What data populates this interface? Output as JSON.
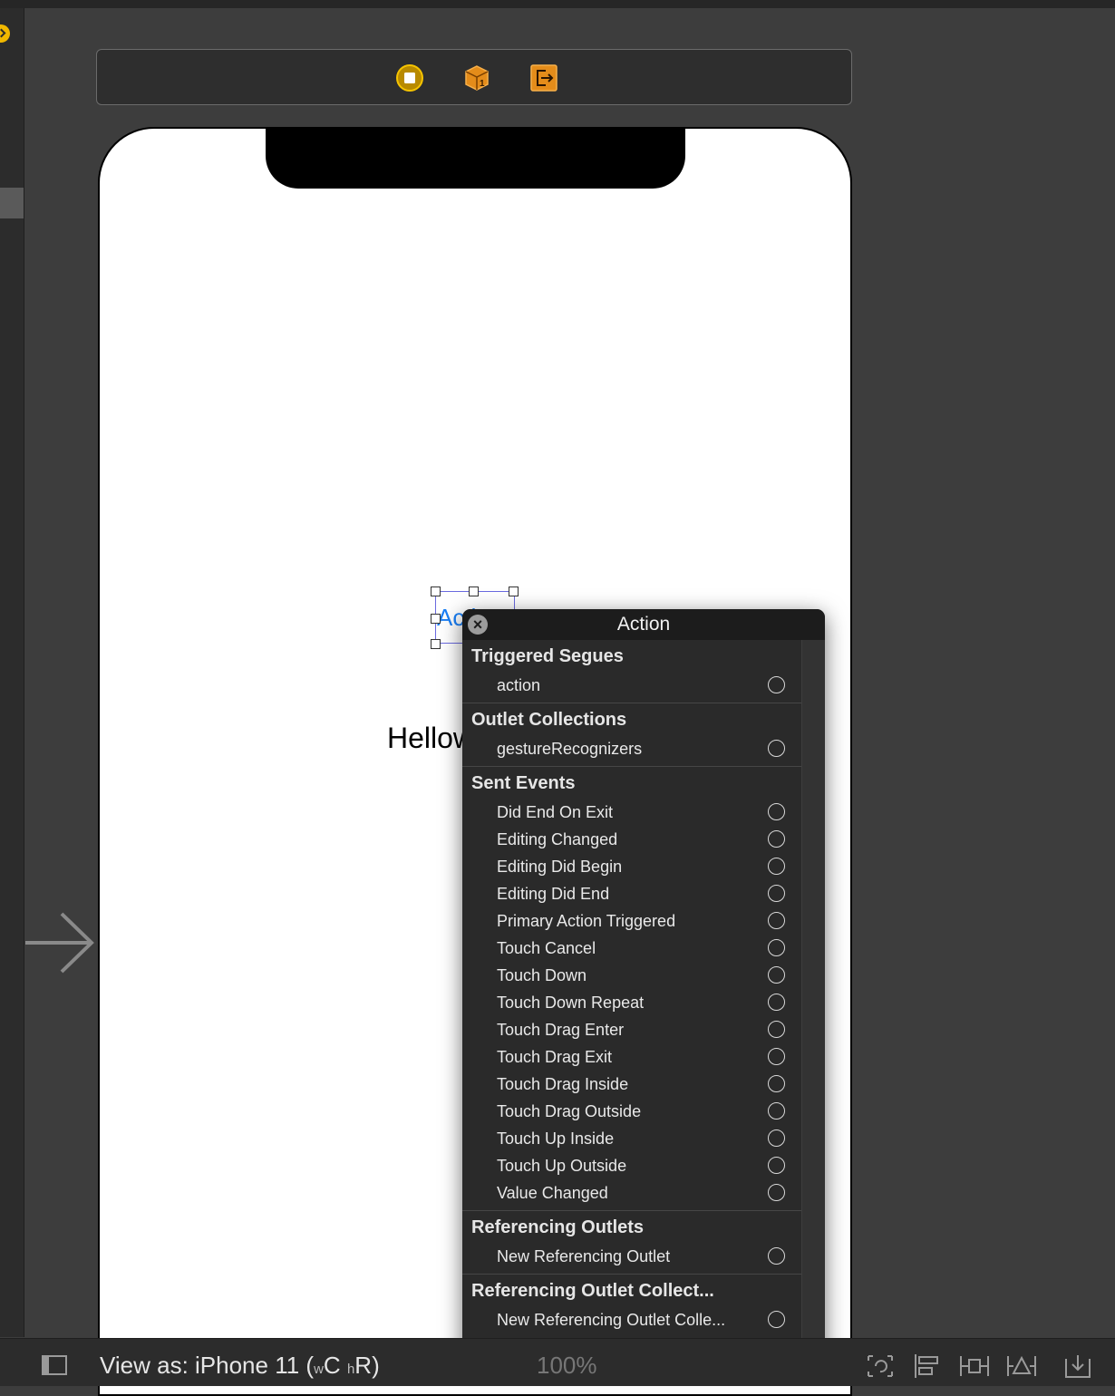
{
  "canvas": {
    "button_title": "Action",
    "label_text": "Hellow wolrd"
  },
  "popover": {
    "title": "Action",
    "sections": [
      {
        "header": "Triggered Segues",
        "items": [
          "action"
        ]
      },
      {
        "header": "Outlet Collections",
        "items": [
          "gestureRecognizers"
        ]
      },
      {
        "header": "Sent Events",
        "items": [
          "Did End On Exit",
          "Editing Changed",
          "Editing Did Begin",
          "Editing Did End",
          "Primary Action Triggered",
          "Touch Cancel",
          "Touch Down",
          "Touch Down Repeat",
          "Touch Drag Enter",
          "Touch Drag Exit",
          "Touch Drag Inside",
          "Touch Drag Outside",
          "Touch Up Inside",
          "Touch Up Outside",
          "Value Changed"
        ]
      },
      {
        "header": "Referencing Outlets",
        "items": [
          "New Referencing Outlet"
        ]
      },
      {
        "header": "Referencing Outlet Collect...",
        "items": [
          "New Referencing Outlet Colle..."
        ]
      }
    ]
  },
  "bottombar": {
    "view_as_prefix": "View as: iPhone 11 (",
    "size_w": "w",
    "size_c": "C",
    "size_h": "h",
    "size_r": "R",
    "view_as_suffix": ")",
    "zoom": "100%"
  },
  "icons": {
    "dock": [
      "view-controller-icon",
      "first-responder-icon",
      "exit-icon"
    ],
    "bottom": [
      "sidebar-toggle-icon",
      "update-frames-icon",
      "align-icon",
      "add-constraints-icon",
      "resolve-issues-icon",
      "embed-in-icon"
    ]
  },
  "colors": {
    "accent": "#f1b800",
    "button_text": "#1a7ff5",
    "selection": "#6a6adf"
  }
}
